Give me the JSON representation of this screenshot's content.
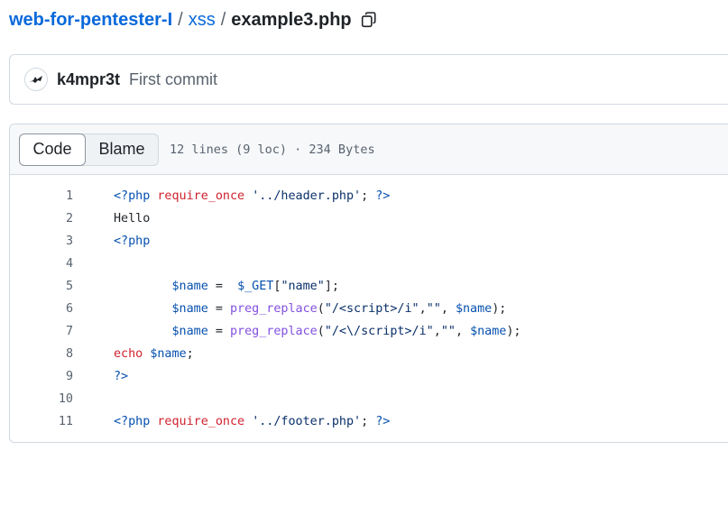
{
  "breadcrumb": {
    "repo": "web-for-pentester-I",
    "folder": "xss",
    "file": "example3.php",
    "separator": "/"
  },
  "commit": {
    "author": "k4mpr3t",
    "message": "First commit"
  },
  "file_header": {
    "code_tab": "Code",
    "blame_tab": "Blame",
    "meta": "12 lines (9 loc) · 234 Bytes"
  },
  "code_lines": [
    {
      "n": "1",
      "tokens": [
        [
          "tag",
          "<?php "
        ],
        [
          "kw",
          "require_once"
        ],
        [
          "p",
          " "
        ],
        [
          "str",
          "'../header.php'"
        ],
        [
          "p",
          "; "
        ],
        [
          "tag",
          "?>"
        ]
      ]
    },
    {
      "n": "2",
      "tokens": [
        [
          "p",
          "Hello"
        ]
      ]
    },
    {
      "n": "3",
      "tokens": [
        [
          "tag",
          "<?php"
        ]
      ]
    },
    {
      "n": "4",
      "tokens": []
    },
    {
      "n": "5",
      "tokens": [
        [
          "p",
          "        "
        ],
        [
          "tag",
          "$name"
        ],
        [
          "p",
          " =  "
        ],
        [
          "tag",
          "$_GET"
        ],
        [
          "p",
          "["
        ],
        [
          "str",
          "\"name\""
        ],
        [
          "p",
          "];"
        ]
      ]
    },
    {
      "n": "6",
      "tokens": [
        [
          "p",
          "        "
        ],
        [
          "tag",
          "$name"
        ],
        [
          "p",
          " = "
        ],
        [
          "fn",
          "preg_replace"
        ],
        [
          "p",
          "("
        ],
        [
          "str",
          "\"/<script>/i\""
        ],
        [
          "p",
          ","
        ],
        [
          "str",
          "\"\""
        ],
        [
          "p",
          ", "
        ],
        [
          "tag",
          "$name"
        ],
        [
          "p",
          ");"
        ]
      ]
    },
    {
      "n": "7",
      "tokens": [
        [
          "p",
          "        "
        ],
        [
          "tag",
          "$name"
        ],
        [
          "p",
          " = "
        ],
        [
          "fn",
          "preg_replace"
        ],
        [
          "p",
          "("
        ],
        [
          "str",
          "\"/<\\/script>/i\""
        ],
        [
          "p",
          ","
        ],
        [
          "str",
          "\"\""
        ],
        [
          "p",
          ", "
        ],
        [
          "tag",
          "$name"
        ],
        [
          "p",
          ");"
        ]
      ]
    },
    {
      "n": "8",
      "tokens": [
        [
          "kw",
          "echo"
        ],
        [
          "p",
          " "
        ],
        [
          "tag",
          "$name"
        ],
        [
          "p",
          ";"
        ]
      ]
    },
    {
      "n": "9",
      "tokens": [
        [
          "tag",
          "?>"
        ]
      ]
    },
    {
      "n": "10",
      "tokens": []
    },
    {
      "n": "11",
      "tokens": [
        [
          "tag",
          "<?php "
        ],
        [
          "kw",
          "require_once"
        ],
        [
          "p",
          " "
        ],
        [
          "str",
          "'../footer.php'"
        ],
        [
          "p",
          "; "
        ],
        [
          "tag",
          "?>"
        ]
      ]
    }
  ],
  "icons": {
    "copy": "copy-icon",
    "avatar": "avatar-icon"
  },
  "colors": {
    "link": "#0969da",
    "keyword": "#cf222e",
    "string": "#0a3069",
    "php_tag": "#0550ae",
    "function": "#8250df"
  }
}
